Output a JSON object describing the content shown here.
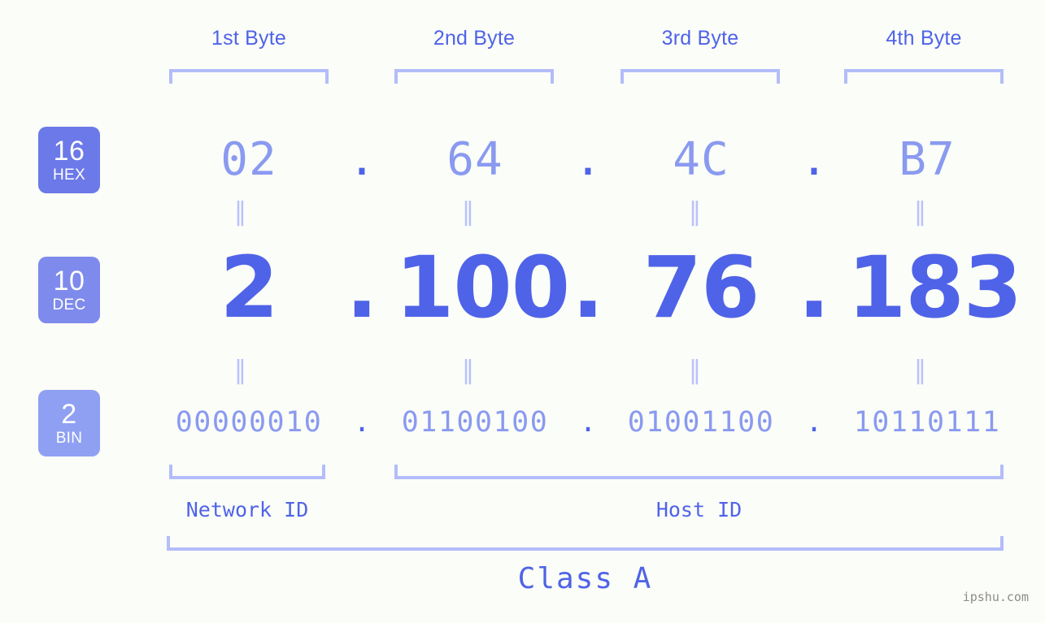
{
  "header": {
    "byte_labels": [
      "1st Byte",
      "2nd Byte",
      "3rd Byte",
      "4th Byte"
    ]
  },
  "bases": {
    "hex": {
      "number": "16",
      "name": "HEX",
      "color": "#6c79e8"
    },
    "dec": {
      "number": "10",
      "name": "DEC",
      "color": "#7e8bec"
    },
    "bin": {
      "number": "2",
      "name": "BIN",
      "color": "#8fa0f2"
    }
  },
  "address": {
    "hex": {
      "octets": [
        "02",
        "64",
        "4C",
        "B7"
      ],
      "separator": "."
    },
    "dec": {
      "octets": [
        "2",
        "100",
        "76",
        "183"
      ],
      "separator": "."
    },
    "bin": {
      "octets": [
        "00000010",
        "01100100",
        "01001100",
        "10110111"
      ],
      "separator": "."
    }
  },
  "equality_marker": "‖",
  "segments": {
    "network_id": "Network ID",
    "host_id": "Host ID",
    "class": "Class A"
  },
  "watermark": "ipshu.com",
  "colors": {
    "background": "#fbfdf8",
    "accent_strong": "#4f63e8",
    "accent_light": "#8a9af0",
    "bracket": "#b3bdfa",
    "equality": "#b9c2fb",
    "watermark": "#8c8c8c"
  }
}
